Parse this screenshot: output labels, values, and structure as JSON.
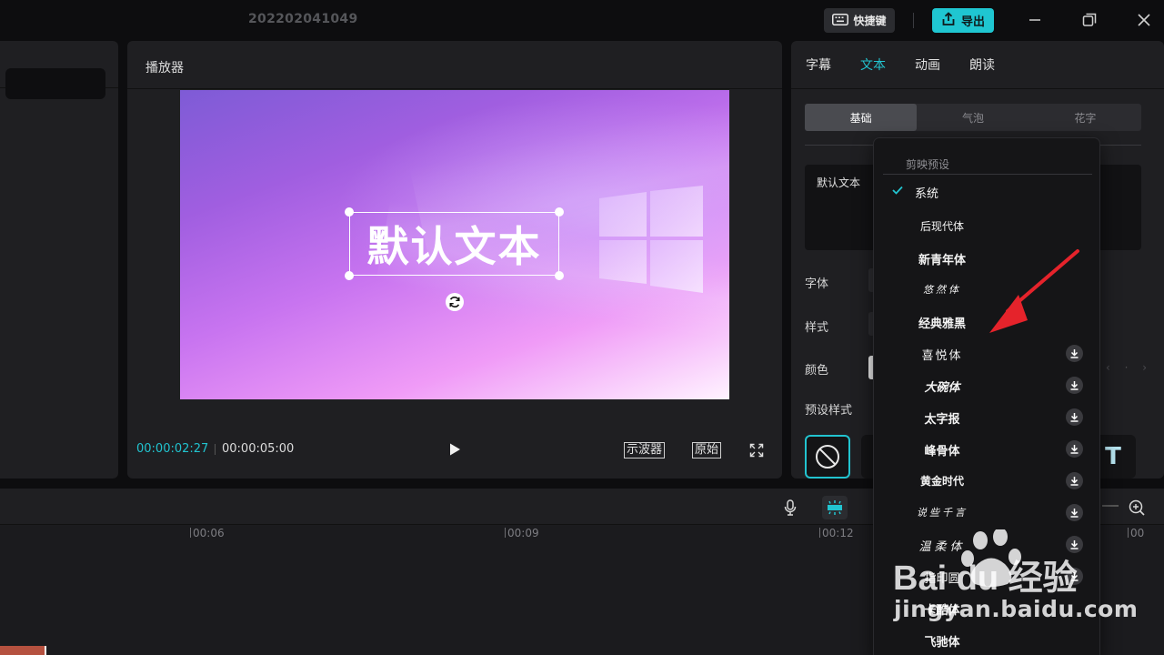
{
  "titlebar": {
    "project_title": "202202041049",
    "shortcut_label": "快捷键",
    "export_label": "导出"
  },
  "player": {
    "header": "播放器",
    "overlay_text": "默认文本",
    "time_current": "00:00:02:27",
    "time_total": "00:00:05:00",
    "oscilloscope_label": "示波器",
    "original_label": "原始"
  },
  "right_panel": {
    "tabs": [
      {
        "label": "字幕"
      },
      {
        "label": "文本",
        "active": true
      },
      {
        "label": "动画"
      },
      {
        "label": "朗读"
      }
    ],
    "subtabs": [
      {
        "label": "基础",
        "active": true
      },
      {
        "label": "气泡"
      },
      {
        "label": "花字"
      }
    ],
    "text_value": "默认文本",
    "font_label": "字体",
    "style_label": "样式",
    "color_label": "颜色",
    "preset_label": "预设样式"
  },
  "font_dropdown": {
    "header": "剪映预设",
    "items": [
      {
        "label": "系统",
        "selected": true,
        "download": false
      },
      {
        "label": "后现代体",
        "download": false
      },
      {
        "label": "新青年体",
        "download": false
      },
      {
        "label": "悠然体",
        "download": false
      },
      {
        "label": "经典雅黑",
        "download": false
      },
      {
        "label": "喜悦体",
        "download": true
      },
      {
        "label": "大碗体",
        "download": true
      },
      {
        "label": "太字报",
        "download": true
      },
      {
        "label": "峰骨体",
        "download": true
      },
      {
        "label": "黄金时代",
        "download": true
      },
      {
        "label": "说些千言",
        "download": true
      },
      {
        "label": "温柔体",
        "download": true
      },
      {
        "label": "指印圆",
        "download": true
      },
      {
        "label": "卡酷体",
        "download": false
      },
      {
        "label": "飞驰体",
        "download": false
      }
    ]
  },
  "timeline": {
    "ticks": [
      "00:06",
      "00:09",
      "00:12",
      "00"
    ]
  },
  "watermark": {
    "brand": "Bai du 经验",
    "url": "jingyan.baidu.com"
  },
  "colors": {
    "accent": "#22c4d0",
    "export_bg": "#1fc6d1",
    "annotation_arrow": "#e5232b"
  }
}
